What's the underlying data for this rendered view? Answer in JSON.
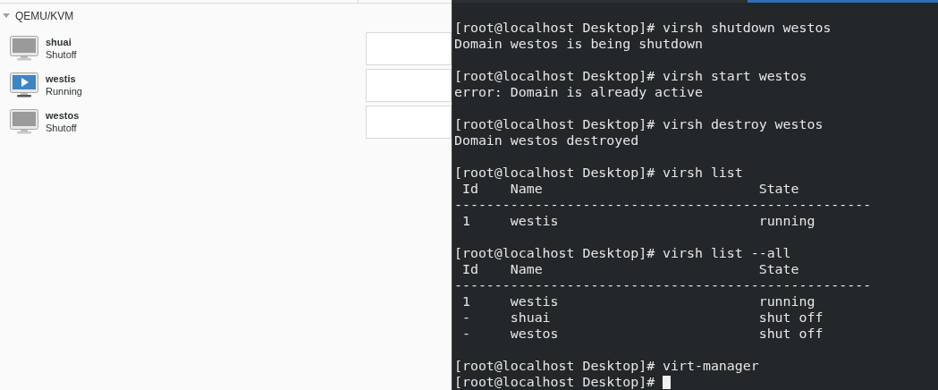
{
  "connection": {
    "label": "QEMU/KVM",
    "expanded": true
  },
  "vms": [
    {
      "name": "shuai",
      "status": "Shutoff",
      "running": false
    },
    {
      "name": "westis",
      "status": "Running",
      "running": true
    },
    {
      "name": "westos",
      "status": "Shutoff",
      "running": false
    }
  ],
  "terminal": {
    "blocks": [
      {
        "lines": [
          "[root@localhost Desktop]# virsh shutdown westos",
          "Domain westos is being shutdown"
        ]
      },
      {
        "lines": [
          "[root@localhost Desktop]# virsh start westos",
          "error: Domain is already active"
        ]
      },
      {
        "lines": [
          "[root@localhost Desktop]# virsh destroy westos",
          "Domain westos destroyed"
        ]
      },
      {
        "lines": [
          "[root@localhost Desktop]# virsh list",
          " Id    Name                           State",
          "----------------------------------------------------",
          " 1     westis                         running"
        ]
      },
      {
        "lines": [
          "[root@localhost Desktop]# virsh list --all",
          " Id    Name                           State",
          "----------------------------------------------------",
          " 1     westis                         running",
          " -     shuai                          shut off",
          " -     westos                         shut off"
        ]
      },
      {
        "lines": [
          "[root@localhost Desktop]# virt-manager",
          "[root@localhost Desktop]#"
        ],
        "cursor": true
      }
    ]
  }
}
